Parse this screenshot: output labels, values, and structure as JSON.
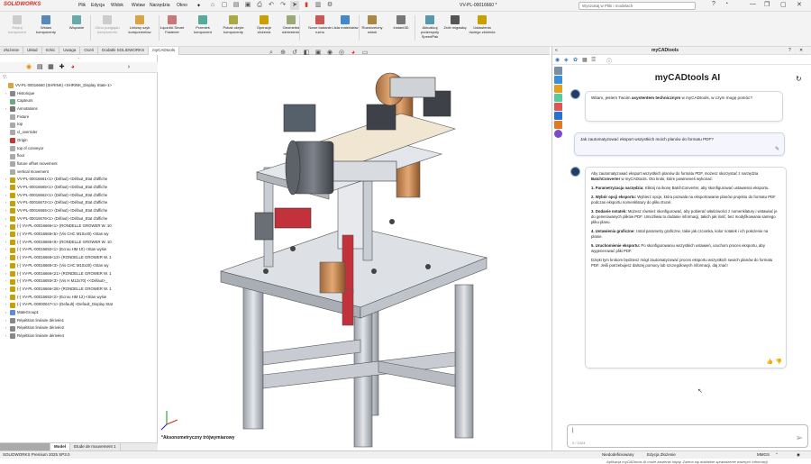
{
  "app": {
    "logo": "SOLIDWORKS",
    "document_title": "VV-PL-00016660 *",
    "search_placeholder": "Wyszukaj w Pliki i modelach",
    "menu": [
      "Plik",
      "Edycja",
      "Widok",
      "Wstaw",
      "Narzędzia",
      "Okno"
    ]
  },
  "ribbon": {
    "buttons": [
      {
        "label": "Edytuj komponent",
        "disabled": true
      },
      {
        "label": "Wstaw komponenty",
        "disabled": false
      },
      {
        "label": "Wiązanie",
        "disabled": false
      },
      {
        "label": "Okno podglądu komponentu",
        "disabled": true
      },
      {
        "label": "Liniowy szyk komponentów",
        "disabled": false
      },
      {
        "label": "Łączniki Smart Fastener",
        "disabled": false
      },
      {
        "label": "Przenieś komponent",
        "disabled": false
      },
      {
        "label": "Pokaż ukryte komponenty",
        "disabled": false
      },
      {
        "label": "Operacje złożenia",
        "disabled": false
      },
      {
        "label": "Geometria odniesienia",
        "disabled": false
      },
      {
        "label": "Nowe badanie ruchu",
        "disabled": false
      },
      {
        "label": "Lista materiałów",
        "disabled": false
      },
      {
        "label": "Rozstrzelony widok",
        "disabled": false
      },
      {
        "label": "Instant3D",
        "disabled": false
      },
      {
        "label": "Aktualizuj podzespoły SpeedPak",
        "disabled": false
      },
      {
        "label": "Zrób migawkę",
        "disabled": false
      },
      {
        "label": "Ustawienia dużego złożenia",
        "disabled": false
      }
    ]
  },
  "tabs": [
    "Złożenie",
    "Układ",
    "Szkic",
    "Uwaga",
    "Oceń",
    "Dodatki SOLIDWORKS",
    "myCADtools"
  ],
  "active_tab": "myCADtools",
  "tree": [
    {
      "text": "VV-PL-00016660 (SHRINK) <SHRINK_Display State-1>",
      "icon": "assembly-icon",
      "color": "#d9a441",
      "arrow": ""
    },
    {
      "text": "Historique",
      "icon": "history-icon",
      "color": "#888",
      "arrow": "›"
    },
    {
      "text": "Capteurs",
      "icon": "sensor-icon",
      "color": "#6a8",
      "arrow": ""
    },
    {
      "text": "Annotations",
      "icon": "annotation-icon",
      "color": "#777",
      "arrow": "›"
    },
    {
      "text": "Fixture",
      "icon": "plane-icon",
      "color": "#aaa",
      "arrow": ""
    },
    {
      "text": "top",
      "icon": "plane-icon",
      "color": "#aaa",
      "arrow": ""
    },
    {
      "text": "cl_overrider",
      "icon": "plane-icon",
      "color": "#aaa",
      "arrow": ""
    },
    {
      "text": "Origin",
      "icon": "origin-icon",
      "color": "#c33",
      "arrow": ""
    },
    {
      "text": "top of conveyor",
      "icon": "plane-icon",
      "color": "#aaa",
      "arrow": ""
    },
    {
      "text": "floor",
      "icon": "plane-icon",
      "color": "#aaa",
      "arrow": ""
    },
    {
      "text": "fixture offset movement",
      "icon": "plane-icon",
      "color": "#aaa",
      "arrow": ""
    },
    {
      "text": "vertical movement",
      "icon": "plane-icon",
      "color": "#aaa",
      "arrow": ""
    },
    {
      "text": "VV-PL-00016661<1> (Défaut) <Défaut_Etat d'affiche",
      "icon": "part-icon",
      "color": "#c9a000",
      "arrow": "›"
    },
    {
      "text": "VV-PL-00016665<1> (Défaut) <Défaut_Etat d'affiche",
      "icon": "part-icon",
      "color": "#c9a000",
      "arrow": "›"
    },
    {
      "text": "VV-PL-00016662<1> (Défaut) <Défaut_Etat d'affiche",
      "icon": "part-icon",
      "color": "#c9a000",
      "arrow": "›"
    },
    {
      "text": "VV-PL-00016672<1> (Défaut) <Défaut_Etat d'affiche",
      "icon": "part-icon",
      "color": "#c9a000",
      "arrow": "›"
    },
    {
      "text": "VV-PL-00016665<1> (Défaut) <Défaut_Etat d'affiche",
      "icon": "part-icon",
      "color": "#c9a000",
      "arrow": "›"
    },
    {
      "text": "VV-PL-00016676<1> (Défaut) <Défaut_Etat d'affiche",
      "icon": "part-icon",
      "color": "#c9a000",
      "arrow": "›"
    },
    {
      "text": "(-) VV-PL-00016666<1> (RONDELLE GROWER W. 10",
      "icon": "part-icon",
      "color": "#c9a000",
      "arrow": "›"
    },
    {
      "text": "(-) VV-PL-00016665<5> (Vis CHC M10x40) <Stan wy",
      "icon": "part-icon",
      "color": "#c9a000",
      "arrow": "›"
    },
    {
      "text": "(-) VV-PL-00016666<9> (RONDELLE GROWER W. 10",
      "icon": "part-icon",
      "color": "#c9a000",
      "arrow": "›"
    },
    {
      "text": "(-) VV-PL-00016692<1> (Ecrou HM 10) <Stan wyśw",
      "icon": "part-icon",
      "color": "#c9a000",
      "arrow": "›"
    },
    {
      "text": "(-) VV-PL-00016666<13> (RONDELLE GROWER W. 1",
      "icon": "part-icon",
      "color": "#c9a000",
      "arrow": "›"
    },
    {
      "text": "(-) VV-PL-00016665<3> (Vis CHC M10x20) <Stan wy",
      "icon": "part-icon",
      "color": "#c9a000",
      "arrow": "›"
    },
    {
      "text": "(-) VV-PL-00016666<21> (RONDELLE GROWER W. 1",
      "icon": "part-icon",
      "color": "#c9a000",
      "arrow": "›"
    },
    {
      "text": "(-) VV-PL-00016693<3> (Vis H M12x70) <<Défaut>_",
      "icon": "part-icon",
      "color": "#c9a000",
      "arrow": "›"
    },
    {
      "text": "(-) VV-PL-00016666<26> (RONDELLE GROWER W. 1",
      "icon": "part-icon",
      "color": "#c9a000",
      "arrow": "›"
    },
    {
      "text": "(-) VV-PL-00016692<2> (Ecrou HM 12) <Stan wyśw",
      "icon": "part-icon",
      "color": "#c9a000",
      "arrow": "›"
    },
    {
      "text": "(-) VV-PL-00000047<1> (Default) <Default_Display Stat",
      "icon": "part-icon",
      "color": "#c9a000",
      "arrow": "›"
    },
    {
      "text": "MateGroup1",
      "icon": "mate-icon",
      "color": "#5a8fd0",
      "arrow": "›"
    },
    {
      "text": "Répétition linéaire dérivée1",
      "icon": "pattern-icon",
      "color": "#888",
      "arrow": "›"
    },
    {
      "text": "Répétition linéaire dérivée2",
      "icon": "pattern-icon",
      "color": "#888",
      "arrow": "›"
    },
    {
      "text": "Répétition linéaire dérivée4",
      "icon": "pattern-icon",
      "color": "#888",
      "arrow": "›"
    }
  ],
  "bottom_tabs": [
    "Model",
    "Etude de mouvement 1"
  ],
  "status": {
    "left": "SOLIDWORKS Premium 2025 SP3.0",
    "mid1": "Niedodefiniowany",
    "mid2": "Edycja Złożenie",
    "units": "MMGS"
  },
  "viewport": {
    "view_label": "*Aksonometryczny trójwymiarowy"
  },
  "panel": {
    "header": "myCADtools",
    "title": "myCADtools AI",
    "msg1": {
      "pre": "Witam, jestem Twoim ",
      "bold": "asystentem technicznym",
      "post": " w myCADtools, w czym mogę pomóc?"
    },
    "user_msg": "Jak zautomatyzować eksport wszystkich moich planów do formatu PDF?",
    "answer_intro": {
      "pre": "Aby zautomatyzować eksport wszystkich planów do formatu PDF, możesz skorzystać z narzędzia ",
      "bold": "BatchConverter",
      "post": " w myCADtools. Oto kroki, które powinieneś wykonać:"
    },
    "steps": [
      {
        "bold": "1. Parametryzacja narzędzia:",
        "text": " Kliknij na ikonę BatchConverter, aby skonfigurować ustawienia eksportu."
      },
      {
        "bold": "2. Wybór opcji eksportu:",
        "text": " Wybierz opcje, która pozwala na eksportowanie planów projektu do formatu PDF podczas eksportu nomenklatury do pliku Excel."
      },
      {
        "bold": "3. Dodanie notatek:",
        "text": " Możesz również skonfigurować, aby pobierać właściwości z nomenklatury i wstawiać je do generowanych plików PDF. Umożliwia to dodanie informacji, takich jak ilość, bez modyfikowania samego pliku planu."
      },
      {
        "bold": "4. Ustawienia graficzne:",
        "text": " Ustal parametry graficzne, takie jak czcionka, kolor notatek i ich położenie na planie."
      },
      {
        "bold": "5. Uruchomienie eksportu:",
        "text": " Po skonfigurowaniu wszystkich ustawień, uruchom proces eksportu, aby wygenerować pliki PDF."
      }
    ],
    "answer_outro": "Dzięki tym krokom będziesz mógł zautomatyzować proces eksportu wszystkich swoich planów do formatu PDF. Jeśli potrzebujesz dalszej pomocy lub szczegółowych informacji, daj znać!",
    "char_count": "0 / 1024",
    "disclaimer": "Aplikacja myCADtools AI może zawierać błędy. Zaleca się dokładne sprawdzenie ważnych informacji."
  }
}
